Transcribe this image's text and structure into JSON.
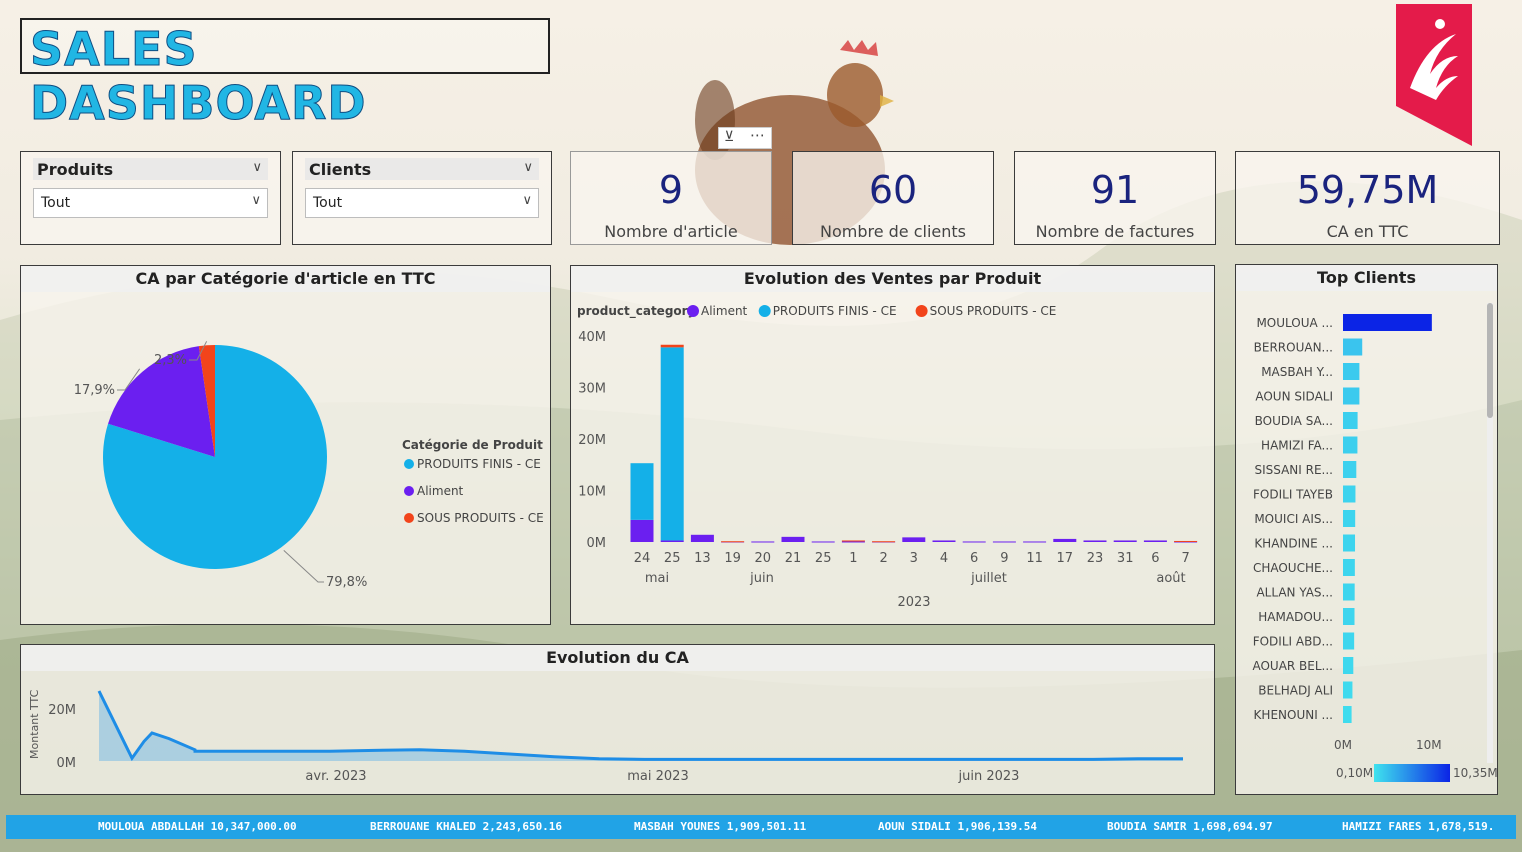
{
  "title": "SALES DASHBOARD",
  "colors": {
    "accent": "#21b6e4",
    "kpi": "#1a237e",
    "logo": "#e41b4a",
    "aliment": "#6b1ff0",
    "finis": "#14b0e8",
    "sous": "#f2441b",
    "bar_top": "#0b24e6"
  },
  "slicers": [
    {
      "label": "Produits",
      "value": "Tout"
    },
    {
      "label": "Clients",
      "value": "Tout"
    }
  ],
  "kpis": [
    {
      "value": "9",
      "label": "Nombre d'article"
    },
    {
      "value": "60",
      "label": "Nombre de clients"
    },
    {
      "value": "91",
      "label": "Nombre de factures"
    },
    {
      "value": "59,75M",
      "label": "CA en TTC"
    }
  ],
  "visual_header_icons": [
    "filter-icon",
    "more-options-icon"
  ],
  "pie": {
    "title": "CA par Catégorie d'article en TTC",
    "legend_title": "Catégorie de Produit",
    "chart_data": {
      "type": "pie",
      "slices": [
        {
          "label": "PRODUITS FINIS - CE",
          "value": 79.8,
          "text": "79,8%",
          "color": "#14b0e8"
        },
        {
          "label": "Aliment",
          "value": 17.9,
          "text": "17,9%",
          "color": "#6b1ff0"
        },
        {
          "label": "SOUS PRODUITS - CE",
          "value": 2.3,
          "text": "2,3%",
          "color": "#f2441b"
        }
      ]
    }
  },
  "stacked": {
    "title": "Evolution des Ventes par Produit",
    "legend_title": "product_category",
    "legend": [
      {
        "label": "Aliment",
        "color": "#6b1ff0"
      },
      {
        "label": "PRODUITS FINIS - CE",
        "color": "#14b0e8"
      },
      {
        "label": "SOUS PRODUITS - CE",
        "color": "#f2441b"
      }
    ],
    "chart_data": {
      "type": "bar",
      "stacked": true,
      "y_ticks": [
        "40M",
        "30M",
        "20M",
        "10M",
        "0M"
      ],
      "ylim": [
        0,
        40
      ],
      "categories": [
        "24",
        "25",
        "13",
        "19",
        "20",
        "21",
        "25",
        "1",
        "2",
        "3",
        "4",
        "6",
        "9",
        "11",
        "17",
        "23",
        "31",
        "6",
        "7"
      ],
      "series": [
        {
          "name": "Aliment",
          "values": [
            4.3,
            0.3,
            1.4,
            0.1,
            0.1,
            1.0,
            0.1,
            0.1,
            0.1,
            0.9,
            0.3,
            0.1,
            0.1,
            0.1,
            0.6,
            0.3,
            0.3,
            0.3,
            0.1
          ]
        },
        {
          "name": "PRODUITS FINIS - CE",
          "values": [
            11.0,
            37.5,
            0,
            0,
            0,
            0,
            0,
            0,
            0,
            0,
            0,
            0,
            0,
            0,
            0,
            0,
            0,
            0,
            0
          ]
        },
        {
          "name": "SOUS PRODUITS - CE",
          "values": [
            0,
            0.5,
            0,
            0.05,
            0,
            0,
            0,
            0.2,
            0.05,
            0,
            0,
            0,
            0,
            0,
            0,
            0,
            0,
            0,
            0.1
          ]
        }
      ],
      "month_labels": [
        "mai",
        "juin",
        "juillet",
        "août"
      ],
      "year_label": "2023"
    }
  },
  "line": {
    "title": "Evolution du CA",
    "ylabel": "Montant TTC",
    "chart_data": {
      "type": "area",
      "y_ticks": [
        "20M",
        "0M"
      ],
      "ylim": [
        0,
        25
      ],
      "x_ticks": [
        "avr. 2023",
        "mai 2023",
        "juin 2023"
      ],
      "values": [
        25,
        1,
        7,
        10,
        8,
        4,
        3.5,
        3.5,
        3.5,
        3.5,
        3.8,
        4,
        3.5,
        2.5,
        1.5,
        0.8,
        0.6,
        0.6,
        0.6,
        0.6,
        0.6,
        0.6,
        0.6,
        0.6,
        0.6,
        0.6,
        0.6,
        0.8,
        0.8
      ]
    }
  },
  "top_clients": {
    "title": "Top Clients",
    "x_ticks": [
      "0M",
      "10M"
    ],
    "gradient_min": "0,10M",
    "gradient_max": "10,35M",
    "chart_data": {
      "type": "bar",
      "orientation": "horizontal",
      "categories": [
        "MOULOUA ...",
        "BERROUAN...",
        "MASBAH Y...",
        "AOUN SIDALI",
        "BOUDIA SA...",
        "HAMIZI FA...",
        "SISSANI RE...",
        "FODILI TAYEB",
        "MOUICI AIS...",
        "KHANDINE ...",
        "CHAOUCHE...",
        "ALLAN YAS...",
        "HAMADOU...",
        "FODILI ABD...",
        "AOUAR BEL...",
        "BELHADJ ALI",
        "KHENOUNI ..."
      ],
      "values": [
        10.35,
        2.24,
        1.91,
        1.91,
        1.7,
        1.68,
        1.55,
        1.45,
        1.42,
        1.4,
        1.38,
        1.36,
        1.34,
        1.3,
        1.2,
        1.1,
        1.0
      ],
      "xlim": [
        0,
        12
      ]
    }
  },
  "ticker": [
    "MOULOUA ABDALLAH 10,347,000.00",
    "BERROUANE KHALED 2,243,650.16",
    "MASBAH YOUNES 1,909,501.11",
    "AOUN SIDALI 1,906,139.54",
    "BOUDIA SAMIR 1,698,694.97",
    "HAMIZI FARES 1,678,519."
  ]
}
